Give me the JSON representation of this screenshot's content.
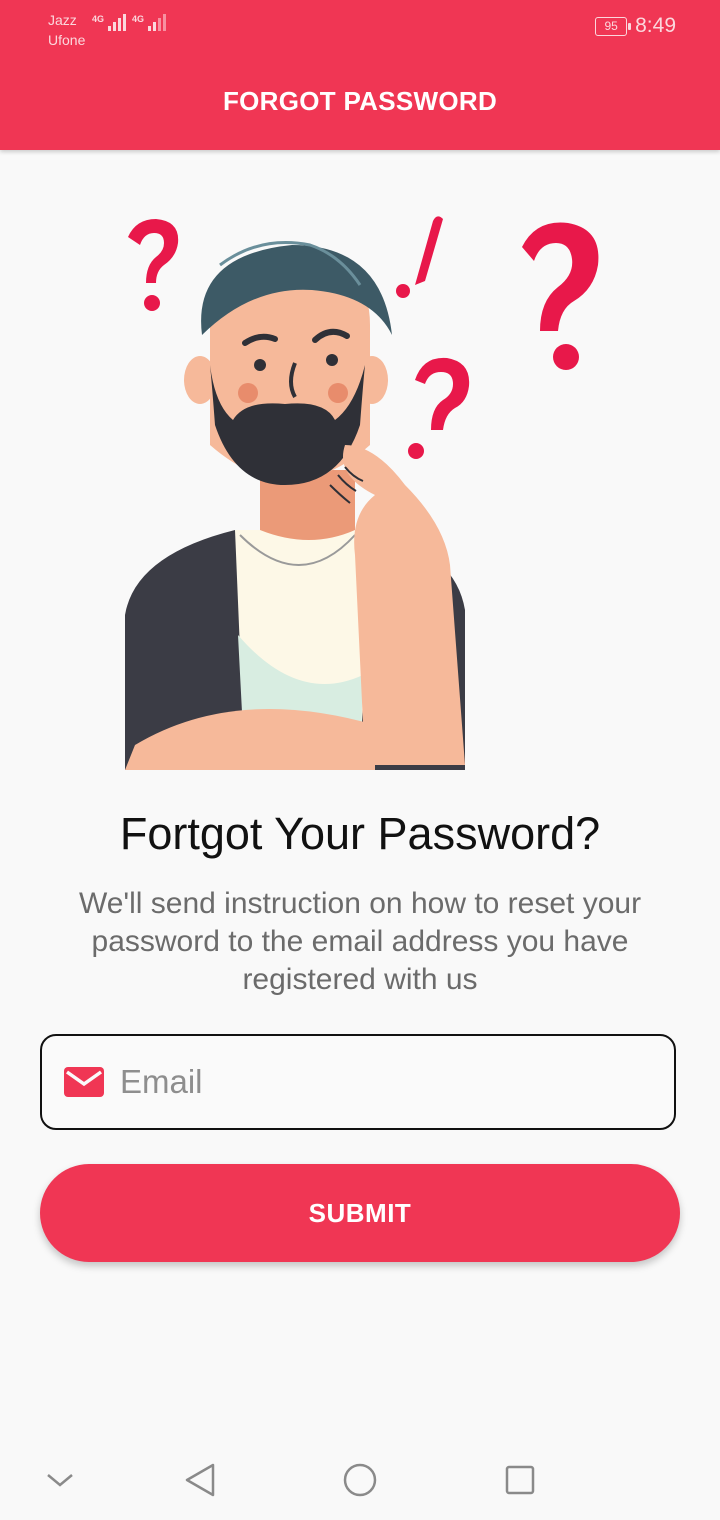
{
  "status_bar": {
    "carrier1": "Jazz",
    "carrier2": "Ufone",
    "network1": "4G",
    "network2": "4G",
    "battery": "95",
    "time": "8:49"
  },
  "app_bar": {
    "title": "FORGOT PASSWORD"
  },
  "main": {
    "heading": "Fortgot Your Password?",
    "description": "We'll send instruction on how to reset your password to the email address you have registered with us",
    "email": {
      "placeholder": "Email",
      "value": ""
    },
    "submit_label": "SUBMIT"
  },
  "icons": {
    "mail": "mail-icon",
    "nav_collapse": "chevron-down-icon",
    "nav_back": "back-triangle-icon",
    "nav_home": "home-circle-icon",
    "nav_recents": "recents-square-icon"
  },
  "colors": {
    "primary": "#f03654",
    "text_dark": "#111111",
    "text_muted": "#6b6b6b",
    "question_marks": "#e8184a"
  }
}
